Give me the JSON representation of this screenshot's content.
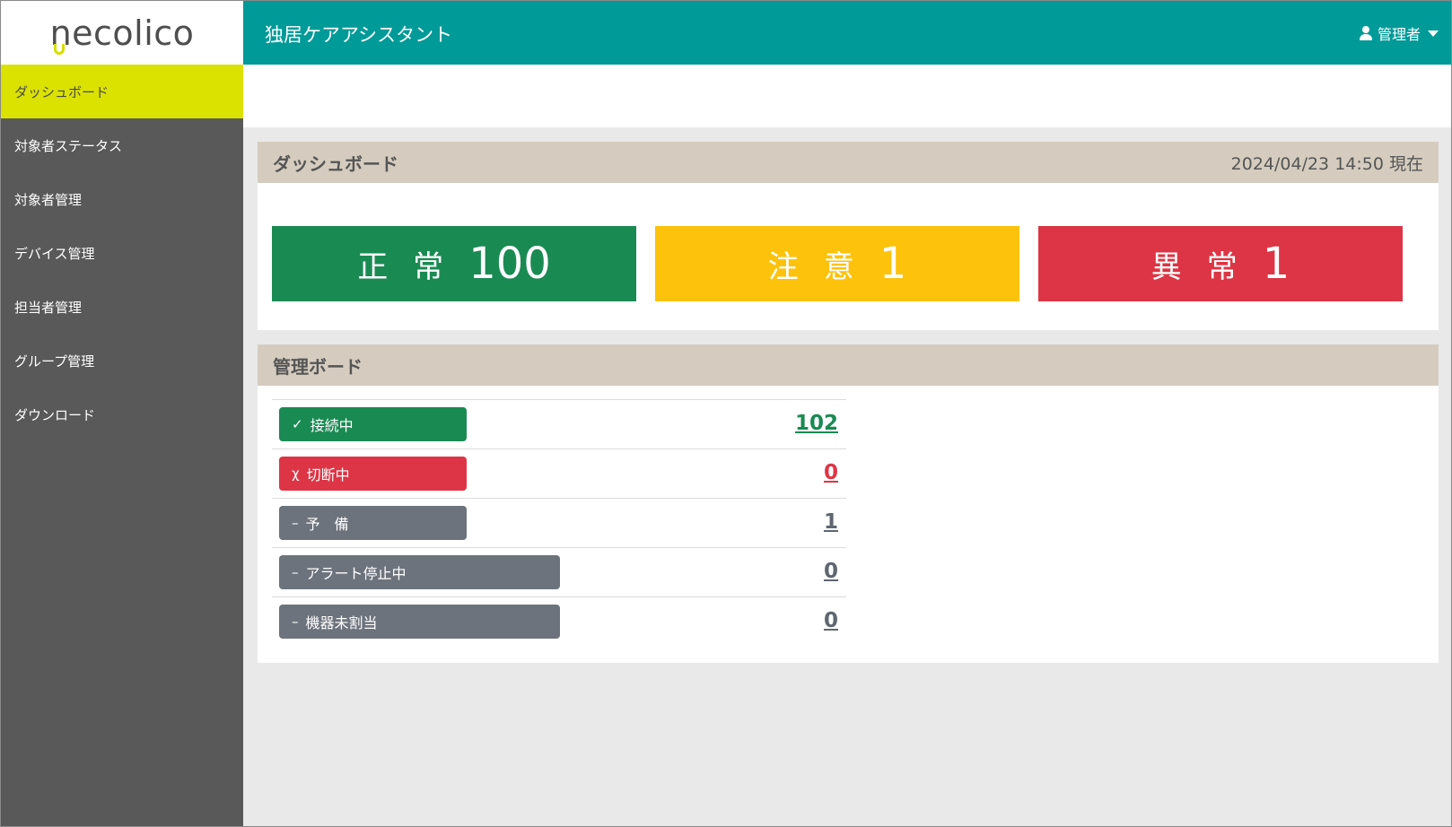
{
  "brand": {
    "logo_text": "necolico"
  },
  "header": {
    "app_title": "独居ケアアシスタント",
    "user_label": "管理者"
  },
  "sidebar": {
    "items": [
      {
        "label": "ダッシュボード",
        "active": true
      },
      {
        "label": "対象者ステータス"
      },
      {
        "label": "対象者管理"
      },
      {
        "label": "デバイス管理"
      },
      {
        "label": "担当者管理"
      },
      {
        "label": "グループ管理"
      },
      {
        "label": "ダウンロード"
      }
    ]
  },
  "dashboard": {
    "title": "ダッシュボード",
    "timestamp": "2024/04/23 14:50 現在",
    "status": [
      {
        "label": "正常",
        "value": "100",
        "color": "#1a8a53"
      },
      {
        "label": "注意",
        "value": "1",
        "color": "#fdc20c"
      },
      {
        "label": "異常",
        "value": "1",
        "color": "#dd3545"
      }
    ]
  },
  "management": {
    "title": "管理ボード",
    "rows": [
      {
        "symbol": "✓",
        "label": "接続中",
        "count": "102",
        "color": "#1a8a53",
        "count_color": "#1a8a53"
      },
      {
        "symbol": "χ",
        "label": "切断中",
        "count": "0",
        "color": "#dd3545",
        "count_color": "#dd3545"
      },
      {
        "symbol": "–",
        "label": "予　備",
        "count": "1",
        "color": "#6c737d",
        "count_color": "#5f6670"
      },
      {
        "symbol": "–",
        "label": "アラート停止中",
        "count": "0",
        "color": "#6c737d",
        "count_color": "#5f6670"
      },
      {
        "symbol": "–",
        "label": "機器未割当",
        "count": "0",
        "color": "#6c737d",
        "count_color": "#5f6670"
      }
    ]
  }
}
